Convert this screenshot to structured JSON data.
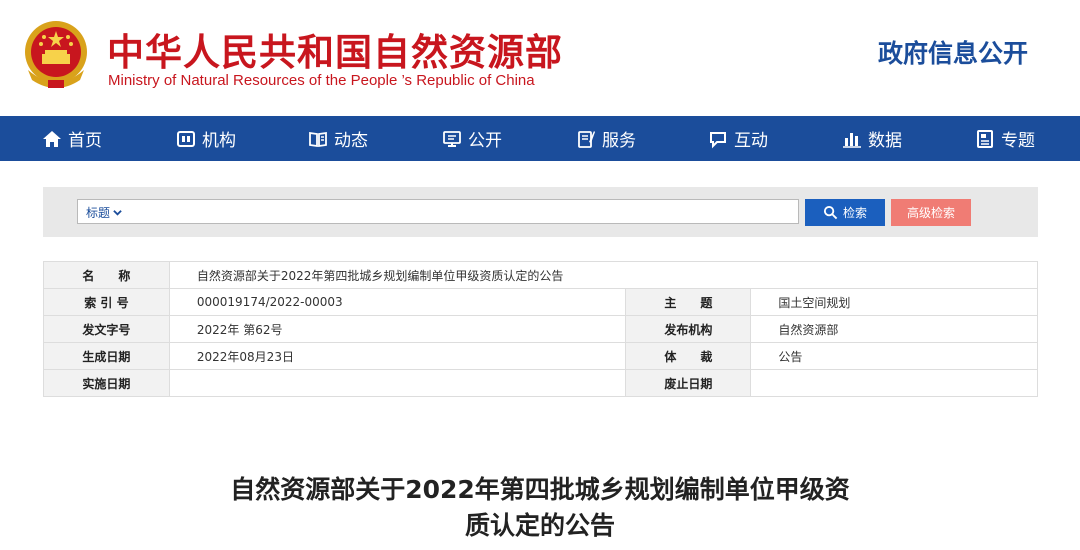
{
  "header": {
    "site_name_cn": "中华人民共和国自然资源部",
    "site_name_en": "Ministry of Natural Resources of the People ’s Republic of China",
    "gov_open_label": "政府信息公开"
  },
  "nav": {
    "items": [
      {
        "label": "首页",
        "icon": "home-icon"
      },
      {
        "label": "机构",
        "icon": "org-icon"
      },
      {
        "label": "动态",
        "icon": "news-icon"
      },
      {
        "label": "公开",
        "icon": "open-icon"
      },
      {
        "label": "服务",
        "icon": "service-icon"
      },
      {
        "label": "互动",
        "icon": "chat-icon"
      },
      {
        "label": "数据",
        "icon": "chart-icon"
      },
      {
        "label": "专题",
        "icon": "topic-icon"
      }
    ]
  },
  "search": {
    "scope_label": "标题",
    "query": "",
    "search_button": "检索",
    "advanced_button": "高级检索"
  },
  "meta": {
    "name_label": "名　　称",
    "name_value": "自然资源部关于2022年第四批城乡规划编制单位甲级资质认定的公告",
    "index_label": "索 引 号",
    "index_value": "000019174/2022-00003",
    "subject_label": "主　　题",
    "subject_value": "国土空间规划",
    "docno_label": "发文字号",
    "docno_value": "2022年 第62号",
    "issuer_label": "发布机构",
    "issuer_value": "自然资源部",
    "date_label": "生成日期",
    "date_value": "2022年08月23日",
    "genre_label": "体　　裁",
    "genre_value": "公告",
    "effective_label": "实施日期",
    "effective_value": "",
    "expiry_label": "废止日期",
    "expiry_value": ""
  },
  "article": {
    "title_line1": "自然资源部关于2022年第四批城乡规划编制单位甲级资",
    "title_line2": "质认定的公告"
  },
  "colors": {
    "brand_red": "#c8161e",
    "nav_blue": "#1b4d9b",
    "search_blue": "#1b5fbe",
    "advanced_red": "#f07c74"
  }
}
